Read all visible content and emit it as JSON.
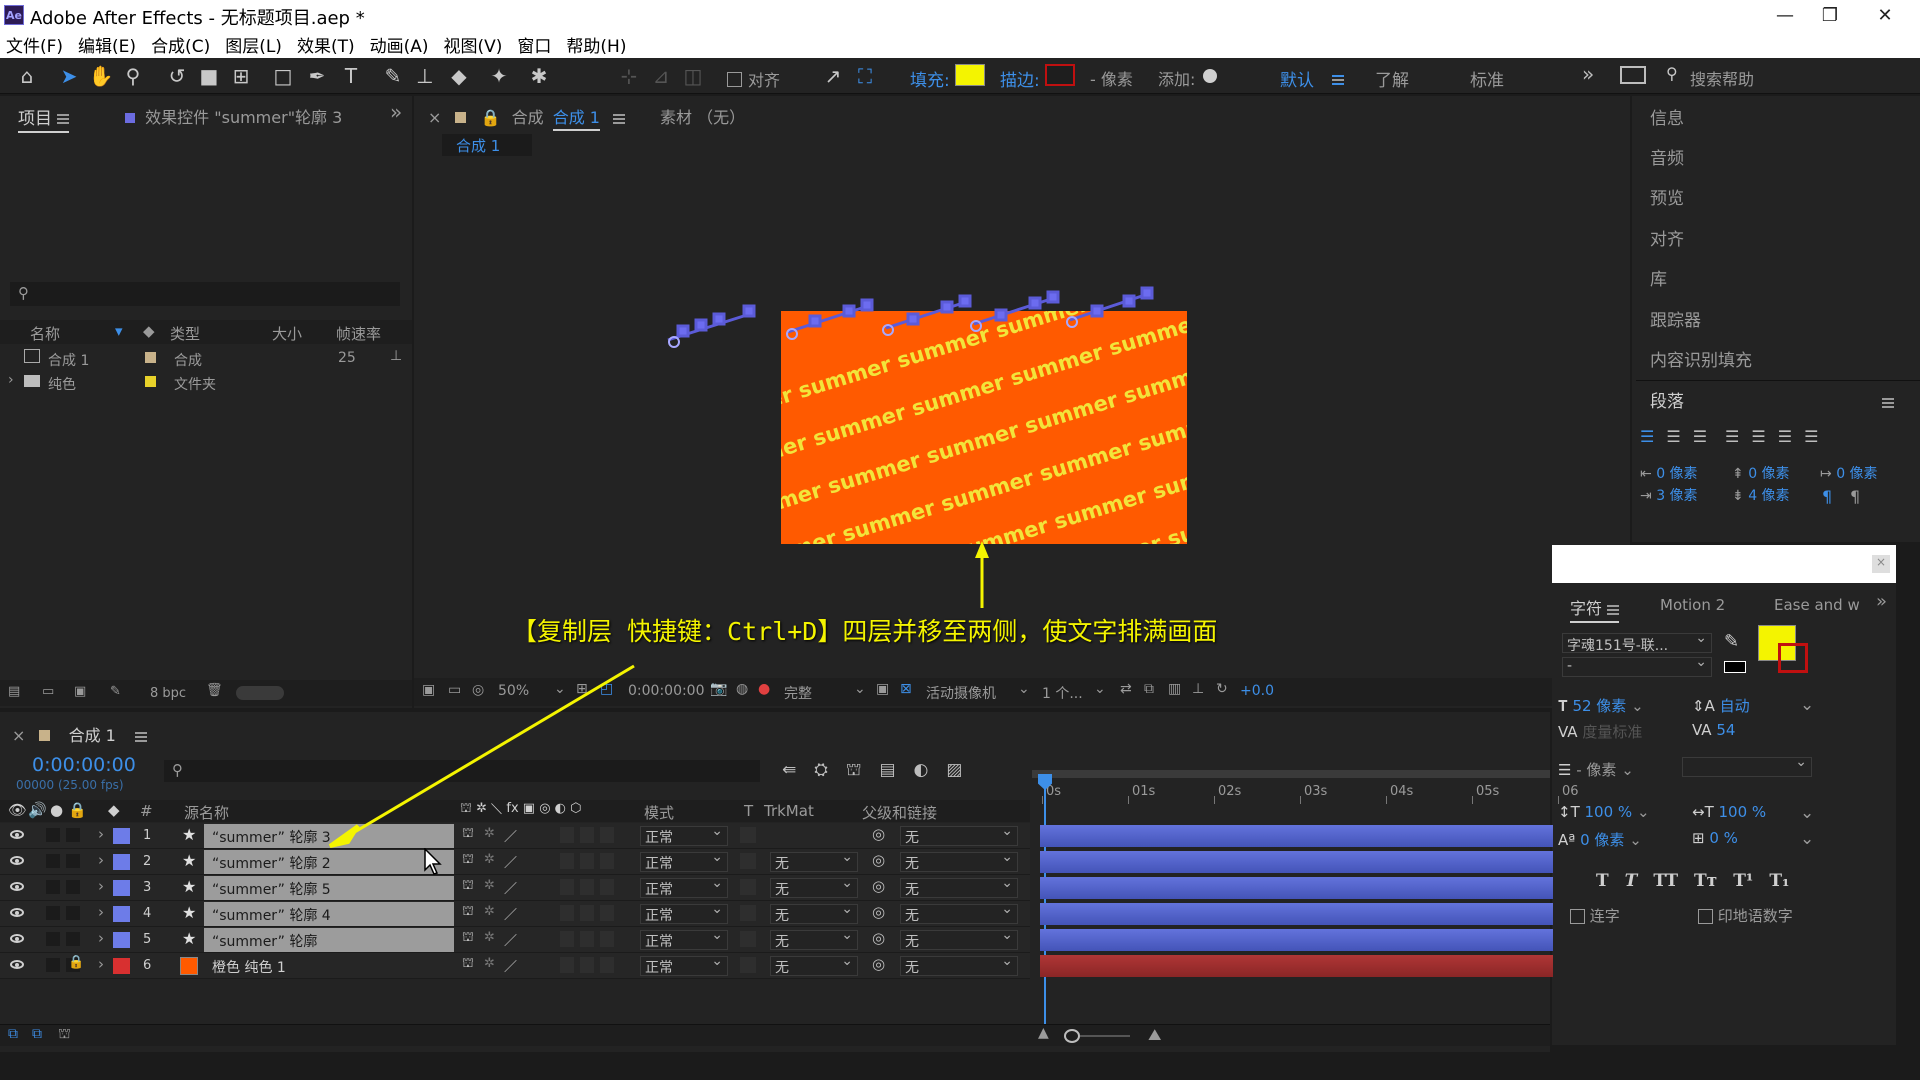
{
  "window": {
    "app_title": "Adobe After Effects - 无标题项目.aep *",
    "logo": "Ae"
  },
  "menu": [
    "文件(F)",
    "编辑(E)",
    "合成(C)",
    "图层(L)",
    "效果(T)",
    "动画(A)",
    "视图(V)",
    "窗口",
    "帮助(H)"
  ],
  "toolbar": {
    "align_label": "对齐",
    "fill_label": "填充:",
    "stroke_label": "描边:",
    "pixels_label": "- 像素",
    "add_label": "添加:",
    "workspace_default": "默认",
    "workspace_learn": "了解",
    "workspace_standard": "标准",
    "search_placeholder": "搜索帮助",
    "fill_color": "#f4f400",
    "stroke_color": "#c01010"
  },
  "project_panel": {
    "tab_project": "项目",
    "tab_effects": "效果控件 \"summer\"轮廓 3",
    "col_name": "名称",
    "col_type": "类型",
    "col_size": "大小",
    "col_fps": "帧速率",
    "items": [
      {
        "name": "合成 1",
        "type": "合成",
        "fps": "25"
      },
      {
        "name": "纯色",
        "type": "文件夹",
        "fps": ""
      }
    ],
    "bpc": "8 bpc"
  },
  "comp_panel": {
    "tab_label": "合成",
    "tab_comp_name": "合成 1",
    "footage_tab": "素材 （无）",
    "breadcrumb": "合成 1",
    "zoom": "50%",
    "timecode": "0:00:00:00",
    "resolution": "完整",
    "camera": "活动摄像机",
    "views": "1 个...",
    "exposure": "+0.0",
    "canvas_text": "summer",
    "bg_color": "#ff5a00",
    "text_color": "#f2e53a"
  },
  "annotation": {
    "text": "【复制层 快捷键：Ctrl+D】四层并移至两侧，使文字排满画面"
  },
  "timeline": {
    "tab": "合成 1",
    "timecode": "0:00:00:00",
    "frames_fps": "00000 (25.00 fps)",
    "col_num": "#",
    "col_source": "源名称",
    "col_mode": "模式",
    "col_t": "T",
    "col_trkmat": "TrkMat",
    "col_parent": "父级和链接",
    "ruler": [
      "0s",
      "01s",
      "02s",
      "03s",
      "04s",
      "05s",
      "06"
    ],
    "layers": [
      {
        "num": "1",
        "name": "“summer” 轮廓 3",
        "mode": "正常",
        "trkmat": "",
        "parent": "无",
        "color": "#6d7ce8"
      },
      {
        "num": "2",
        "name": "“summer” 轮廓 2",
        "mode": "正常",
        "trkmat": "无",
        "parent": "无",
        "color": "#6d7ce8"
      },
      {
        "num": "3",
        "name": "“summer” 轮廓 5",
        "mode": "正常",
        "trkmat": "无",
        "parent": "无",
        "color": "#6d7ce8"
      },
      {
        "num": "4",
        "name": "“summer” 轮廓 4",
        "mode": "正常",
        "trkmat": "无",
        "parent": "无",
        "color": "#6d7ce8"
      },
      {
        "num": "5",
        "name": "“summer” 轮廓",
        "mode": "正常",
        "trkmat": "无",
        "parent": "无",
        "color": "#6d7ce8"
      },
      {
        "num": "6",
        "name": "橙色 纯色 1",
        "mode": "正常",
        "trkmat": "无",
        "parent": "无",
        "color": "#d83030"
      }
    ]
  },
  "right_panel": {
    "items": [
      "信息",
      "音频",
      "预览",
      "对齐",
      "库",
      "跟踪器",
      "内容识别填充"
    ],
    "paragraph_title": "段落",
    "para_values": [
      "0 像素",
      "0 像素",
      "0 像素",
      "3 像素",
      "4 像素"
    ]
  },
  "character_panel": {
    "tab_char": "字符",
    "tab_motion": "Motion 2",
    "tab_ease": "Ease and w",
    "font_family": "字魂151号-联...",
    "font_style": "-",
    "font_size": "52 像素",
    "leading": "自动",
    "kerning": "度量标准",
    "tracking": "54",
    "stroke_width": "- 像素",
    "vscale": "100 %",
    "hscale": "100 %",
    "baseline": "0 像素",
    "tsume": "0 %",
    "ligature": "连字",
    "hindi": "印地语数字",
    "fill_color": "#f4f400"
  }
}
